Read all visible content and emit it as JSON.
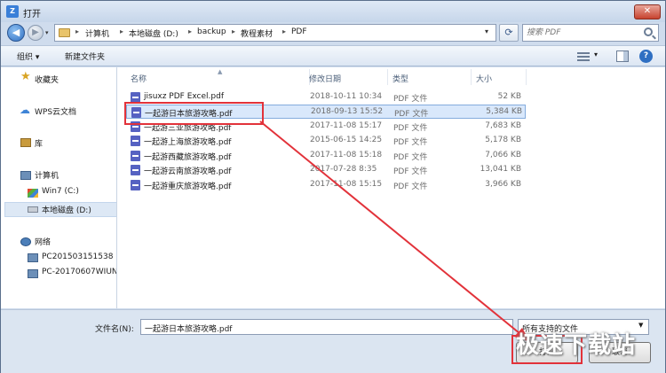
{
  "window": {
    "title": "打开",
    "app_icon_text": "Z"
  },
  "address": {
    "crumbs": [
      "计算机",
      "本地磁盘 (D:)",
      "backup",
      "教程素材",
      "PDF"
    ]
  },
  "search": {
    "placeholder": "搜索 PDF"
  },
  "toolbar": {
    "organize_label": "组织 ▾",
    "new_folder_label": "新建文件夹"
  },
  "navpane": {
    "items": [
      {
        "label": "收藏夹",
        "icon": "star-icon"
      },
      {
        "label": "WPS云文档",
        "icon": "cloud-icon"
      },
      {
        "label": "库",
        "icon": "library-icon"
      },
      {
        "label": "计算机",
        "icon": "computer-icon"
      },
      {
        "label": "Win7 (C:)",
        "icon": "drive-icon"
      },
      {
        "label": "本地磁盘 (D:)",
        "icon": "drive-icon"
      },
      {
        "label": "网络",
        "icon": "network-icon"
      },
      {
        "label": "PC201503151538",
        "icon": "pc-icon"
      },
      {
        "label": "PC-20170607WIUN",
        "icon": "pc-icon"
      }
    ]
  },
  "columns": {
    "name": "名称",
    "date": "修改日期",
    "type": "类型",
    "size": "大小"
  },
  "files": [
    {
      "name": "jisuxz PDF Excel.pdf",
      "date": "2018-10-11 10:34",
      "type": "PDF 文件",
      "size": "52 KB"
    },
    {
      "name": "一起游日本旅游攻略.pdf",
      "date": "2018-09-13 15:52",
      "type": "PDF 文件",
      "size": "5,384 KB"
    },
    {
      "name": "一起游三亚旅游攻略.pdf",
      "date": "2017-11-08 15:17",
      "type": "PDF 文件",
      "size": "7,683 KB"
    },
    {
      "name": "一起游上海旅游攻略.pdf",
      "date": "2015-06-15 14:25",
      "type": "PDF 文件",
      "size": "5,178 KB"
    },
    {
      "name": "一起游西藏旅游攻略.pdf",
      "date": "2017-11-08 15:18",
      "type": "PDF 文件",
      "size": "7,066 KB"
    },
    {
      "name": "一起游云南旅游攻略.pdf",
      "date": "2017-07-28 8:35",
      "type": "PDF 文件",
      "size": "13,041 KB"
    },
    {
      "name": "一起游重庆旅游攻略.pdf",
      "date": "2017-11-08 15:15",
      "type": "PDF 文件",
      "size": "3,966 KB"
    }
  ],
  "bottom": {
    "filename_label": "文件名(N):",
    "filename_value": "一起游日本旅游攻略.pdf",
    "filter_value": "所有支持的文件",
    "open_label": "打开",
    "cancel_label": "取消"
  },
  "watermark": "极速下载站",
  "colors": {
    "highlight": "#e2323a",
    "selection": "#d9e8fb",
    "pdf_icon": "#5662c2"
  }
}
